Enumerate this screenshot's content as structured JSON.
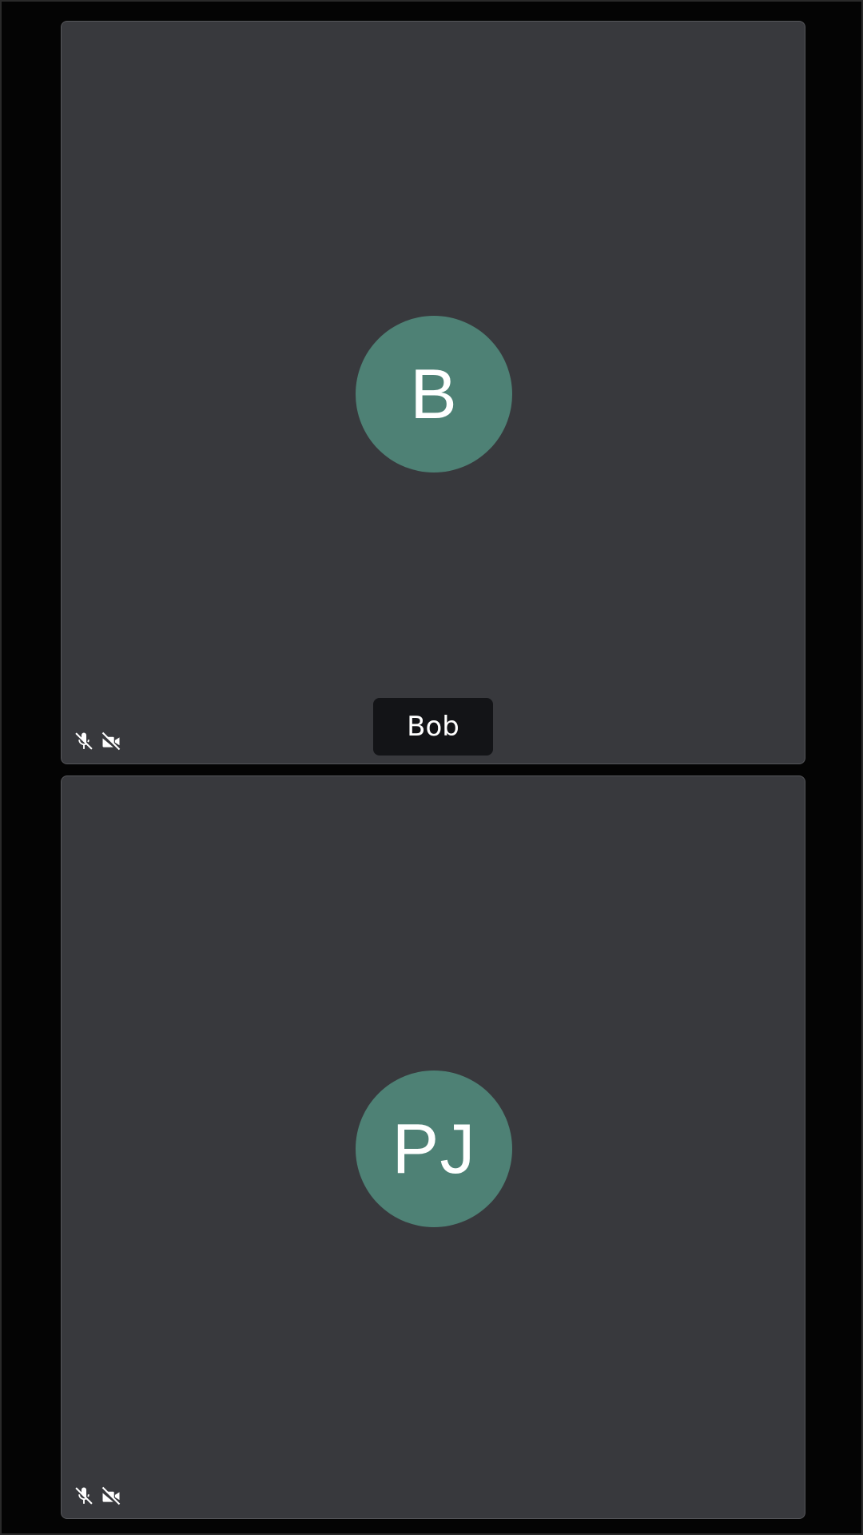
{
  "colors": {
    "background": "#000000",
    "tile_background": "#38393d",
    "avatar_background": "#4e8175",
    "name_label_background": "#131417",
    "text": "#ffffff"
  },
  "participants": [
    {
      "initials": "B",
      "name_label": "Bob",
      "mic_icon": "mic-off-icon",
      "camera_icon": "camera-off-icon"
    },
    {
      "initials": "PJ",
      "mic_icon": "mic-off-icon",
      "camera_icon": "camera-off-icon"
    }
  ]
}
